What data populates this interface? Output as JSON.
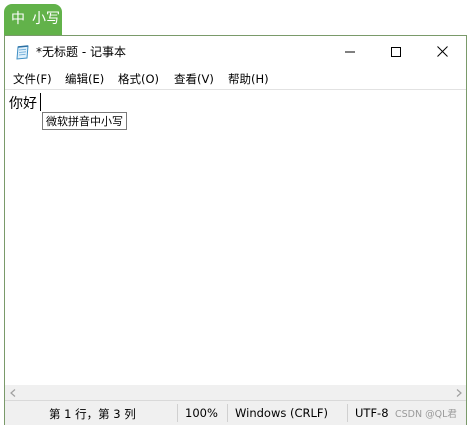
{
  "ime_status": {
    "mode": "中",
    "case": "小写"
  },
  "window": {
    "title": "*无标题 - 记事本"
  },
  "menu": {
    "items": [
      "文件(F)",
      "编辑(E)",
      "格式(O)",
      "查看(V)",
      "帮助(H)"
    ]
  },
  "editor": {
    "content": "你好"
  },
  "ime_candidate": {
    "text": "微软拼音中小写"
  },
  "status": {
    "position": "第 1 行，第 3 列",
    "zoom": "100%",
    "line_endings": "Windows (CRLF)",
    "encoding": "UTF-8"
  },
  "watermark": "CSDN @QL君"
}
